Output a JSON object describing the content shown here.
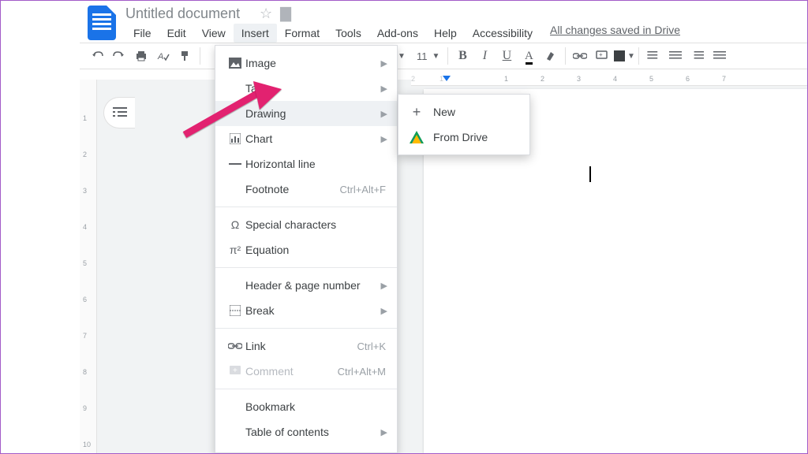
{
  "title": {
    "doc_name": "Untitled document"
  },
  "menubar": {
    "file": "File",
    "edit": "Edit",
    "view": "View",
    "insert": "Insert",
    "format": "Format",
    "tools": "Tools",
    "addons": "Add-ons",
    "help": "Help",
    "accessibility": "Accessibility",
    "save_status": "All changes saved in Drive"
  },
  "toolbar": {
    "font_size": "11"
  },
  "insert_menu": {
    "image": "Image",
    "table": "Table",
    "drawing": "Drawing",
    "chart": "Chart",
    "hr": "Horizontal line",
    "footnote": "Footnote",
    "footnote_sc": "Ctrl+Alt+F",
    "special_chars": "Special characters",
    "equation": "Equation",
    "header_page": "Header & page number",
    "brk": "Break",
    "link": "Link",
    "link_sc": "Ctrl+K",
    "comment": "Comment",
    "comment_sc": "Ctrl+Alt+M",
    "bookmark": "Bookmark",
    "toc": "Table of contents"
  },
  "drawing_submenu": {
    "new": "New",
    "from_drive": "From Drive"
  },
  "vruler": {
    "t1": "1",
    "t2": "2",
    "t3": "3",
    "t4": "4",
    "t5": "5",
    "t6": "6",
    "t7": "7",
    "t8": "8",
    "t9": "9",
    "t10": "10"
  },
  "hruler": {
    "r2": "2",
    "r1": "1",
    "r3": "1",
    "r4": "2",
    "r5": "3",
    "r6": "4",
    "r7": "5",
    "r8": "6",
    "r9": "7"
  }
}
